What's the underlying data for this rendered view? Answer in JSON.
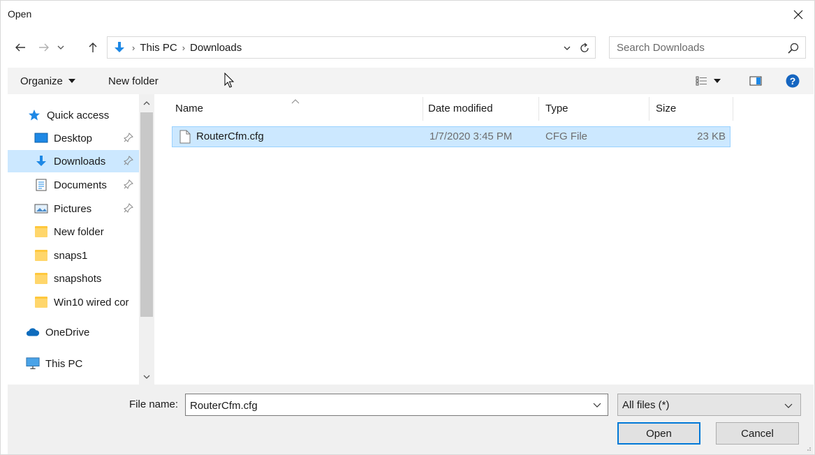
{
  "window": {
    "title": "Open"
  },
  "nav": {
    "back_icon": "back-arrow-icon",
    "forward_icon": "forward-arrow-icon",
    "recent_icon": "chevron-down-icon",
    "up_icon": "up-arrow-icon"
  },
  "address": {
    "crumbs": [
      "This PC",
      "Downloads"
    ],
    "separator": "›"
  },
  "search": {
    "placeholder": "Search Downloads"
  },
  "toolbar": {
    "organize_label": "Organize",
    "new_folder_label": "New folder"
  },
  "sidebar": {
    "items": [
      {
        "label": "Quick access",
        "icon": "star-icon"
      },
      {
        "label": "Desktop",
        "icon": "desktop-icon",
        "pinned": true
      },
      {
        "label": "Downloads",
        "icon": "download-icon",
        "pinned": true,
        "selected": true
      },
      {
        "label": "Documents",
        "icon": "documents-icon",
        "pinned": true
      },
      {
        "label": "Pictures",
        "icon": "pictures-icon",
        "pinned": true
      },
      {
        "label": "New folder",
        "icon": "folder-icon"
      },
      {
        "label": "snaps1",
        "icon": "folder-icon"
      },
      {
        "label": "snapshots",
        "icon": "folder-icon"
      },
      {
        "label": "Win10 wired cor",
        "icon": "folder-icon"
      },
      {
        "label": "OneDrive",
        "icon": "cloud-icon"
      },
      {
        "label": "This PC",
        "icon": "computer-icon"
      }
    ]
  },
  "columns": {
    "name": "Name",
    "date": "Date modified",
    "type": "Type",
    "size": "Size"
  },
  "files": [
    {
      "name": "RouterCfm.cfg",
      "date": "1/7/2020 3:45 PM",
      "type": "CFG File",
      "size": "23 KB",
      "selected": true
    }
  ],
  "bottom": {
    "file_name_label": "File name:",
    "file_name_value": "RouterCfm.cfg",
    "filter_value": "All files (*)",
    "open_label": "Open",
    "cancel_label": "Cancel"
  },
  "colors": {
    "selection_bg": "#cce8ff",
    "selection_border": "#99d1ff",
    "accent": "#0078d7",
    "folder": "#ffd66b"
  }
}
